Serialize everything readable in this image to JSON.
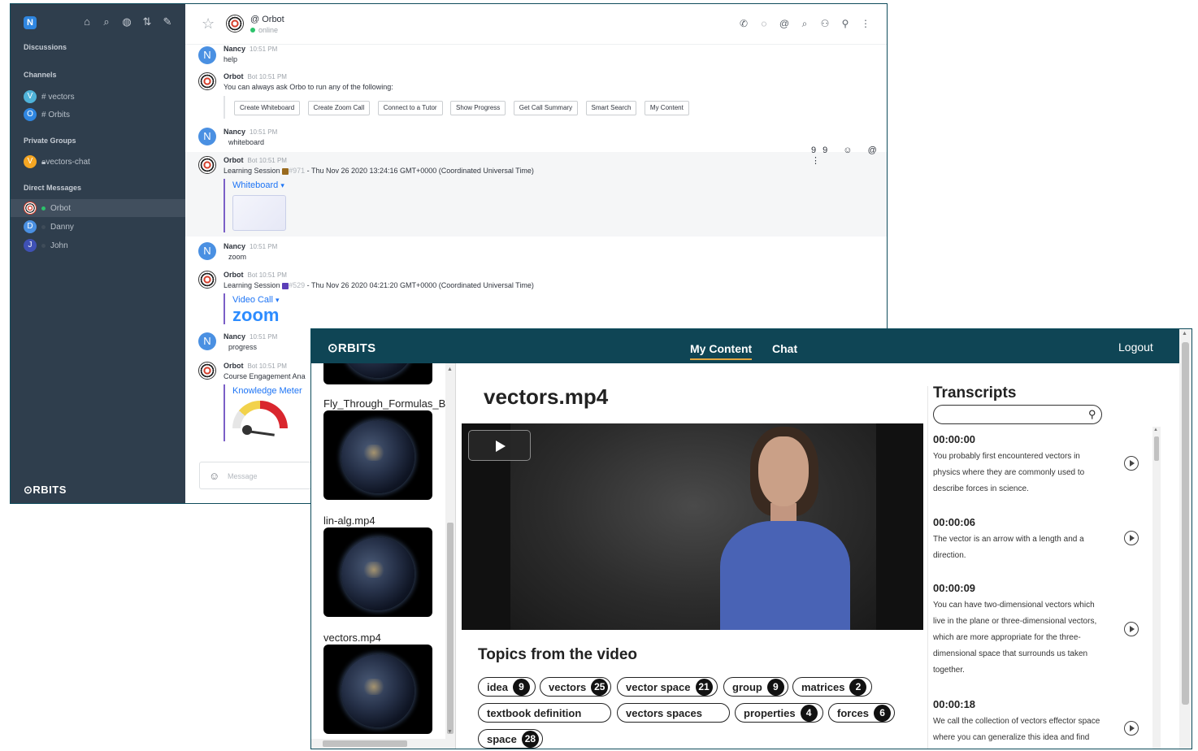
{
  "chat": {
    "me_initial": "N",
    "sidebar": {
      "discussions": "Discussions",
      "channels_title": "Channels",
      "channels": [
        {
          "initial": "V",
          "name": "vectors",
          "color": "#4fb3d9"
        },
        {
          "initial": "O",
          "name": "Orbits",
          "color": "#2f86e0"
        }
      ],
      "groups_title": "Private Groups",
      "groups": [
        {
          "initial": "V",
          "name": "vectors-chat",
          "color": "#f5a623"
        }
      ],
      "dm_title": "Direct Messages",
      "dms": [
        {
          "initial": "",
          "name": "Orbot",
          "color": "#d43d2a"
        },
        {
          "initial": "D",
          "name": "Danny",
          "color": "#4a90e2"
        },
        {
          "initial": "J",
          "name": "John",
          "color": "#3f51b5"
        }
      ],
      "logo": "⊙RBITS",
      "tool_icons": [
        "⌂",
        "⌕",
        "◍",
        "⇅",
        "✎"
      ]
    },
    "header": {
      "title": "@ Orbot",
      "status": "online",
      "star": "☆",
      "icons": [
        "✆",
        "◌",
        "@",
        "⌕",
        "⚇",
        "⚲",
        "⋮"
      ]
    },
    "messages": [
      {
        "name": "Nancy",
        "meta": "10:51 PM",
        "text": "help"
      },
      {
        "name": "Orbot",
        "meta": "Bot  10:51 PM",
        "text": "You can always ask Orbo to run any of the following:"
      },
      {
        "name": "Nancy",
        "meta": "10:51 PM",
        "text": "whiteboard"
      },
      {
        "name": "Orbot",
        "meta": "Bot  10:51 PM",
        "prefix": "Learning Session",
        "tag": "#971",
        "tag_color": "#9a6b1f",
        "text": " - Thu Nov 26 2020 13:24:16 GMT+0000 (Coordinated Universal Time)",
        "attachment": "Whiteboard"
      },
      {
        "name": "Nancy",
        "meta": "10:51 PM",
        "text": "zoom"
      },
      {
        "name": "Orbot",
        "meta": "Bot  10:51 PM",
        "prefix": "Learning Session",
        "tag": "#529",
        "tag_color": "#5b3fb8",
        "text": " - Thu Nov 26 2020 04:21:20 GMT+0000 (Coordinated Universal Time)",
        "attachment": "Video Call",
        "brand": "zoom"
      },
      {
        "name": "Nancy",
        "meta": "10:51 PM",
        "text": "progress"
      },
      {
        "name": "Orbot",
        "meta": "Bot  10:51 PM",
        "text": "Course Engagement Ana",
        "attachment": "Knowledge Meter"
      }
    ],
    "action_buttons": [
      "Create Whiteboard",
      "Create Zoom Call",
      "Connect to a Tutor",
      "Show Progress",
      "Get Call Summary",
      "Smart Search",
      "My Content"
    ],
    "hover_icons": "99 ☺ @ ⋮",
    "composer_placeholder": "Message",
    "composer_icon": "☺"
  },
  "orbits": {
    "brand": "⊙RBITS",
    "tabs": [
      "My Content",
      "Chat"
    ],
    "logout": "Logout",
    "files": [
      "Fly_Through_Formulas_Bl",
      "lin-alg.mp4",
      "vectors.mp4"
    ],
    "video_title": "vectors.mp4",
    "topics_title": "Topics from the video",
    "topics": [
      {
        "label": "idea",
        "count": "9"
      },
      {
        "label": "vectors",
        "count": "25"
      },
      {
        "label": "vector space",
        "count": "21"
      },
      {
        "label": "group",
        "count": "9"
      },
      {
        "label": "matrices",
        "count": "2"
      },
      {
        "label": "textbook definition",
        "count": ""
      },
      {
        "label": "vectors spaces",
        "count": ""
      },
      {
        "label": "properties",
        "count": "4"
      },
      {
        "label": "forces",
        "count": "6"
      },
      {
        "label": "space",
        "count": "28"
      }
    ],
    "transcripts_title": "Transcripts",
    "transcripts": [
      {
        "time": "00:00:00",
        "lines": [
          "You probably first encountered vectors in",
          "physics where they are commonly used to",
          "describe forces in science."
        ]
      },
      {
        "time": "00:00:06",
        "lines": [
          "The vector is an arrow with a length and a",
          "direction."
        ]
      },
      {
        "time": "00:00:09",
        "lines": [
          "You can have two-dimensional vectors which",
          "live in the plane or three-dimensional vectors,",
          "which are more appropriate for the three-",
          "dimensional space that surrounds us taken",
          "together."
        ]
      },
      {
        "time": "00:00:18",
        "lines": [
          "We call the collection of vectors effector space",
          "where you can generalize this idea and find"
        ]
      }
    ],
    "search_icon": "⚲"
  }
}
